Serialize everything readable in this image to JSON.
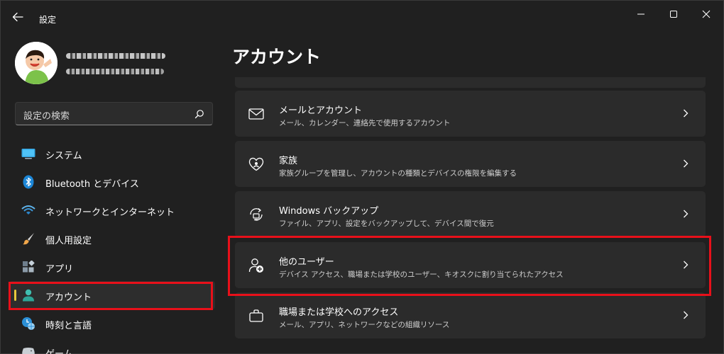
{
  "window": {
    "title": "設定"
  },
  "sidebar": {
    "search_placeholder": "設定の検索",
    "items": [
      {
        "label": "システム",
        "icon": "system-icon"
      },
      {
        "label": "Bluetooth とデバイス",
        "icon": "bluetooth-icon"
      },
      {
        "label": "ネットワークとインターネット",
        "icon": "network-icon"
      },
      {
        "label": "個人用設定",
        "icon": "brush-icon"
      },
      {
        "label": "アプリ",
        "icon": "apps-icon"
      },
      {
        "label": "アカウント",
        "icon": "account-icon",
        "selected": true
      },
      {
        "label": "時刻と言語",
        "icon": "clock-globe-icon"
      },
      {
        "label": "ゲーム",
        "icon": "game-icon"
      }
    ]
  },
  "main": {
    "page_title": "アカウント",
    "cards": [
      {
        "title": "メールとアカウント",
        "description": "メール、カレンダー、連絡先で使用するアカウント",
        "icon": "mail-icon"
      },
      {
        "title": "家族",
        "description": "家族グループを管理し、アカウントの種類とデバイスの権限を編集する",
        "icon": "family-heart-icon"
      },
      {
        "title": "Windows バックアップ",
        "description": "ファイル、アプリ、設定をバックアップして、デバイス間で復元",
        "icon": "backup-icon"
      },
      {
        "title": "他のユーザー",
        "description": "デバイス アクセス、職場または学校のユーザー、キオスクに割り当てられたアクセス",
        "icon": "add-user-icon",
        "highlighted": true
      },
      {
        "title": "職場または学校へのアクセス",
        "description": "メール、アプリ、ネットワークなどの組織リソース",
        "icon": "briefcase-icon"
      }
    ]
  },
  "colors": {
    "accent_indicator": "#e6c93c",
    "annotation_red": "#e8101a",
    "card_bg": "#2b2b2b",
    "window_bg": "#202020"
  }
}
